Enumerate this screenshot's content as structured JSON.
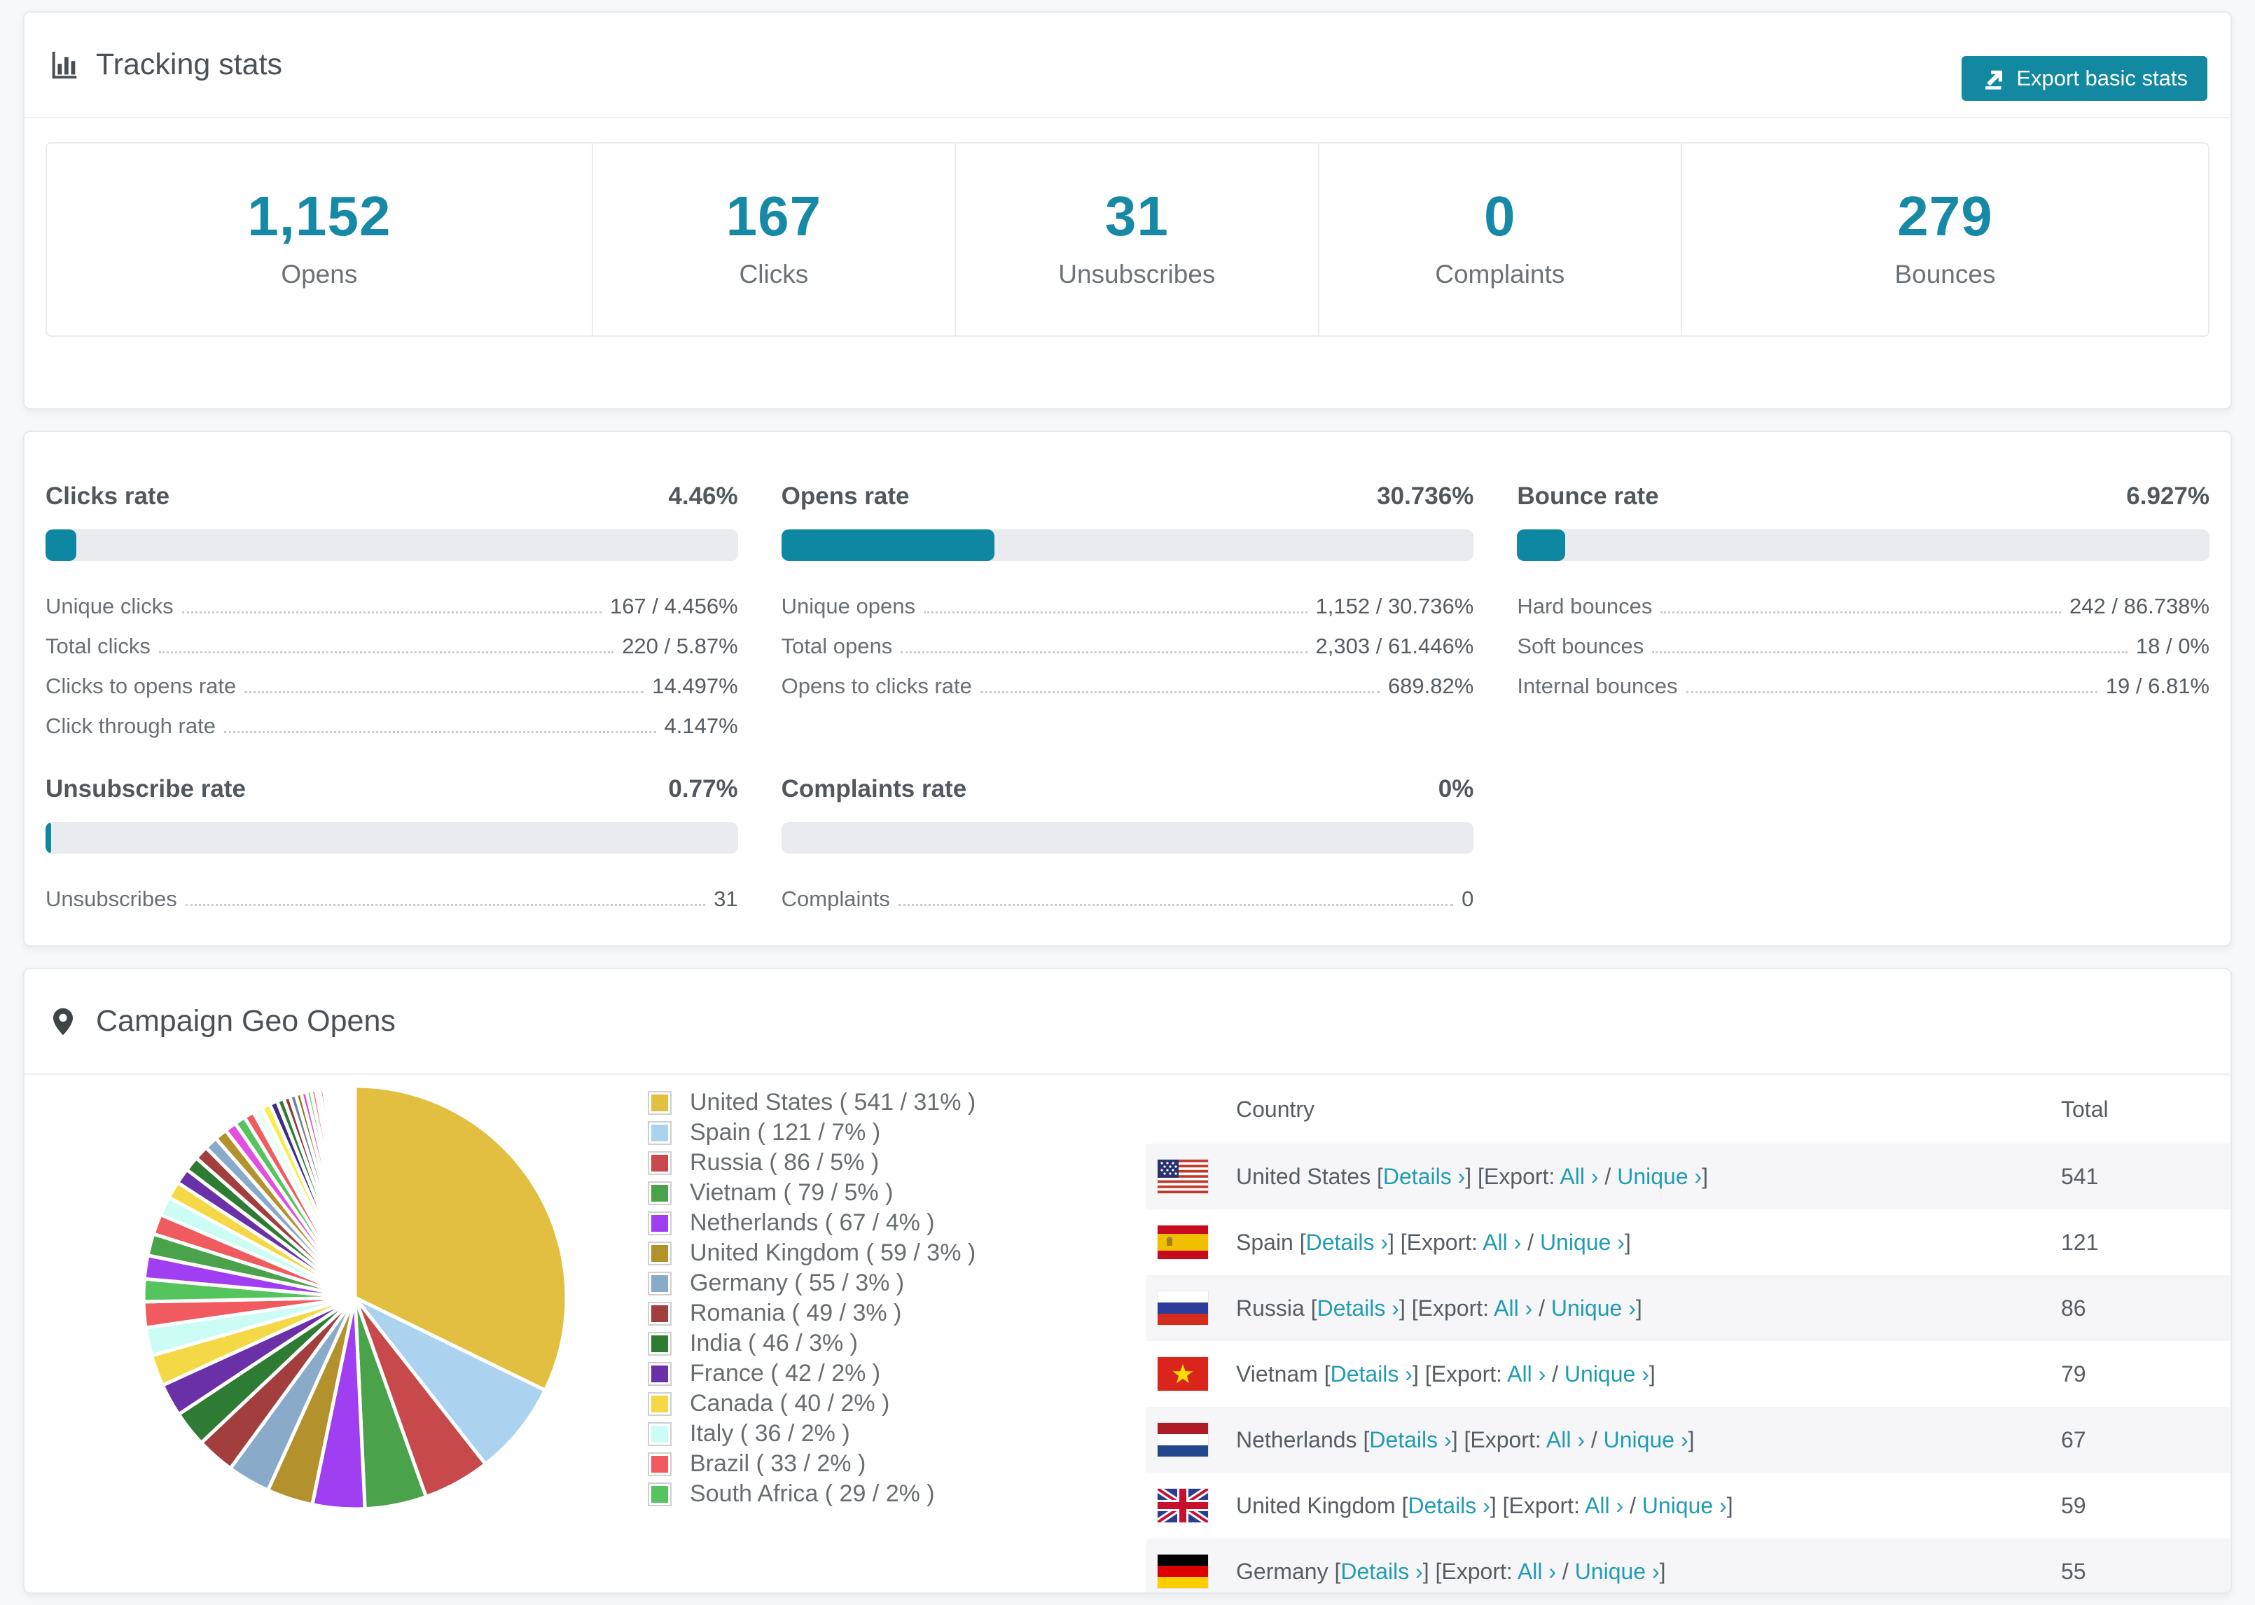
{
  "page": {
    "bg": "#f7f8f9"
  },
  "colors": {
    "accent": "#0e87a3",
    "link": "#219cb3",
    "stat_number": "#1689a6",
    "title_text": "#4a5157",
    "body_text": "#697075",
    "bar_track": "#e9ebee",
    "zebra_row": "#f6f6f8",
    "button_bg": "#1389a1"
  },
  "tracking": {
    "title": "Tracking stats",
    "export_label": "Export basic stats",
    "stats": [
      {
        "value": "1,152",
        "label": "Opens"
      },
      {
        "value": "167",
        "label": "Clicks"
      },
      {
        "value": "31",
        "label": "Unsubscribes"
      },
      {
        "value": "0",
        "label": "Complaints"
      },
      {
        "value": "279",
        "label": "Bounces"
      }
    ]
  },
  "rates": {
    "row1": [
      {
        "title": "Clicks rate",
        "value": "4.46%",
        "percent": 4.46,
        "rows": [
          {
            "label": "Unique clicks",
            "value": "167 / 4.456%"
          },
          {
            "label": "Total clicks",
            "value": "220 / 5.87%"
          },
          {
            "label": "Clicks to opens rate",
            "value": "14.497%"
          },
          {
            "label": "Click through rate",
            "value": "4.147%"
          }
        ]
      },
      {
        "title": "Opens rate",
        "value": "30.736%",
        "percent": 30.736,
        "rows": [
          {
            "label": "Unique opens",
            "value": "1,152 / 30.736%"
          },
          {
            "label": "Total opens",
            "value": "2,303 / 61.446%"
          },
          {
            "label": "Opens to clicks rate",
            "value": "689.82%"
          }
        ]
      },
      {
        "title": "Bounce rate",
        "value": "6.927%",
        "percent": 6.927,
        "rows": [
          {
            "label": "Hard bounces",
            "value": "242 / 86.738%"
          },
          {
            "label": "Soft bounces",
            "value": "18 / 0%"
          },
          {
            "label": "Internal bounces",
            "value": "19 / 6.81%"
          }
        ]
      }
    ],
    "row2": [
      {
        "title": "Unsubscribe rate",
        "value": "0.77%",
        "percent": 0.77,
        "rows": [
          {
            "label": "Unsubscribes",
            "value": "31"
          }
        ]
      },
      {
        "title": "Complaints rate",
        "value": "0%",
        "percent": 0,
        "rows": [
          {
            "label": "Complaints",
            "value": "0"
          }
        ]
      }
    ]
  },
  "geo": {
    "title": "Campaign Geo Opens",
    "headers": {
      "country": "Country",
      "total": "Total"
    },
    "links": {
      "details": "Details ›",
      "export": "Export:",
      "all": "All ›",
      "unique": "Unique ›"
    },
    "rows": [
      {
        "country": "United States",
        "flag": "us",
        "total": "541"
      },
      {
        "country": "Spain",
        "flag": "es",
        "total": "121"
      },
      {
        "country": "Russia",
        "flag": "ru",
        "total": "86"
      },
      {
        "country": "Vietnam",
        "flag": "vn",
        "total": "79"
      },
      {
        "country": "Netherlands",
        "flag": "nl",
        "total": "67"
      },
      {
        "country": "United Kingdom",
        "flag": "gb",
        "total": "59"
      },
      {
        "country": "Germany",
        "flag": "de",
        "total": "55"
      }
    ]
  },
  "chart_data": {
    "type": "pie",
    "title": "Campaign Geo Opens",
    "legend_position": "right",
    "start_angle": "top",
    "direction": "clockwise",
    "slices": [
      {
        "label": "United States",
        "value": 541,
        "pct": "31%",
        "color": "#e2bf41"
      },
      {
        "label": "Spain",
        "value": 121,
        "pct": "7%",
        "color": "#abd3f0"
      },
      {
        "label": "Russia",
        "value": 86,
        "pct": "5%",
        "color": "#c7494b"
      },
      {
        "label": "Vietnam",
        "value": 79,
        "pct": "5%",
        "color": "#4aa24a"
      },
      {
        "label": "Netherlands",
        "value": 67,
        "pct": "4%",
        "color": "#a03ef2"
      },
      {
        "label": "United Kingdom",
        "value": 59,
        "pct": "3%",
        "color": "#b3912c"
      },
      {
        "label": "Germany",
        "value": 55,
        "pct": "3%",
        "color": "#8aaac9"
      },
      {
        "label": "Romania",
        "value": 49,
        "pct": "3%",
        "color": "#a23e3e"
      },
      {
        "label": "India",
        "value": 46,
        "pct": "3%",
        "color": "#2e7c34"
      },
      {
        "label": "France",
        "value": 42,
        "pct": "2%",
        "color": "#6930a8"
      },
      {
        "label": "Canada",
        "value": 40,
        "pct": "2%",
        "color": "#f5d845"
      },
      {
        "label": "Italy",
        "value": 36,
        "pct": "2%",
        "color": "#ccfdf5"
      },
      {
        "label": "Brazil",
        "value": 33,
        "pct": "2%",
        "color": "#ef5b5e"
      },
      {
        "label": "South Africa",
        "value": 29,
        "pct": "2%",
        "color": "#56c45e"
      }
    ],
    "others": {
      "note": "remaining unlabeled countries shown as shrinking slices",
      "values": [
        30,
        28,
        26,
        24,
        22,
        20,
        19,
        18,
        17,
        16,
        15,
        14,
        13,
        12,
        11,
        10,
        9,
        8,
        8,
        7,
        7,
        6,
        6,
        5,
        5,
        4,
        4,
        4,
        3,
        3,
        3,
        2,
        2,
        2,
        2,
        1,
        1,
        1,
        1,
        1,
        1,
        1,
        1,
        1,
        1,
        1
      ],
      "colors": [
        "#a03ef2",
        "#4aa24a",
        "#ef5b5e",
        "#ccfdf5",
        "#f5d845",
        "#6930a8",
        "#2e7c34",
        "#a23e3e",
        "#8aaac9",
        "#b3912c",
        "#e04fe0",
        "#56c45e",
        "#ef5b5e",
        "#eafdfb",
        "#f5ee4e",
        "#3a2d8e",
        "#2e7c34",
        "#8e3a3a",
        "#6b86a0",
        "#8a7a1e",
        "#d94fd9",
        "#5fd45f",
        "#fa6a6a",
        "#abd3f0",
        "#c7494b",
        "#4aa24a",
        "#a03ef2",
        "#e2bf41",
        "#b3912c",
        "#8aaac9",
        "#a23e3e",
        "#2e7c34",
        "#6930a8",
        "#f5d845",
        "#ccfdf5",
        "#ef5b5e",
        "#56c45e",
        "#e04fe0",
        "#abd3f0",
        "#c7494b",
        "#4aa24a",
        "#a03ef2",
        "#e2bf41",
        "#b3912c",
        "#8aaac9",
        "#a23e3e"
      ]
    }
  }
}
